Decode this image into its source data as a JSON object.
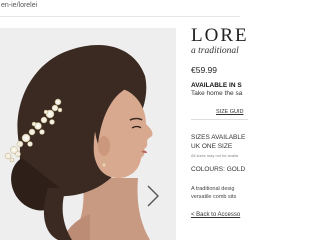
{
  "browser": {
    "url_fragment": "en-ie/lorelei"
  },
  "product": {
    "image_icon": "hair-comb-model-photo",
    "next_icon": "chevron-right-icon",
    "title": "LOREL",
    "subtitle": "a traditional",
    "price": "€59.99",
    "availability": "AVAILABLE IN S",
    "take_home": "Take home the sa",
    "size_guide": "SIZE GUID",
    "sizes_label": "SIZES AVAILABLE",
    "size_value": "UK ONE SIZE",
    "size_note": "All sizes may not be availa",
    "colours": "COLOURS: GOLD",
    "description_line1": "A traditional desig",
    "description_line2": "versatile comb sits",
    "back_link": "< Back to Accesso"
  },
  "colors": {
    "image_bg": "#eeeeef",
    "hair": "#3a2a22",
    "skin": "#d9a98f",
    "text": "#222222"
  }
}
